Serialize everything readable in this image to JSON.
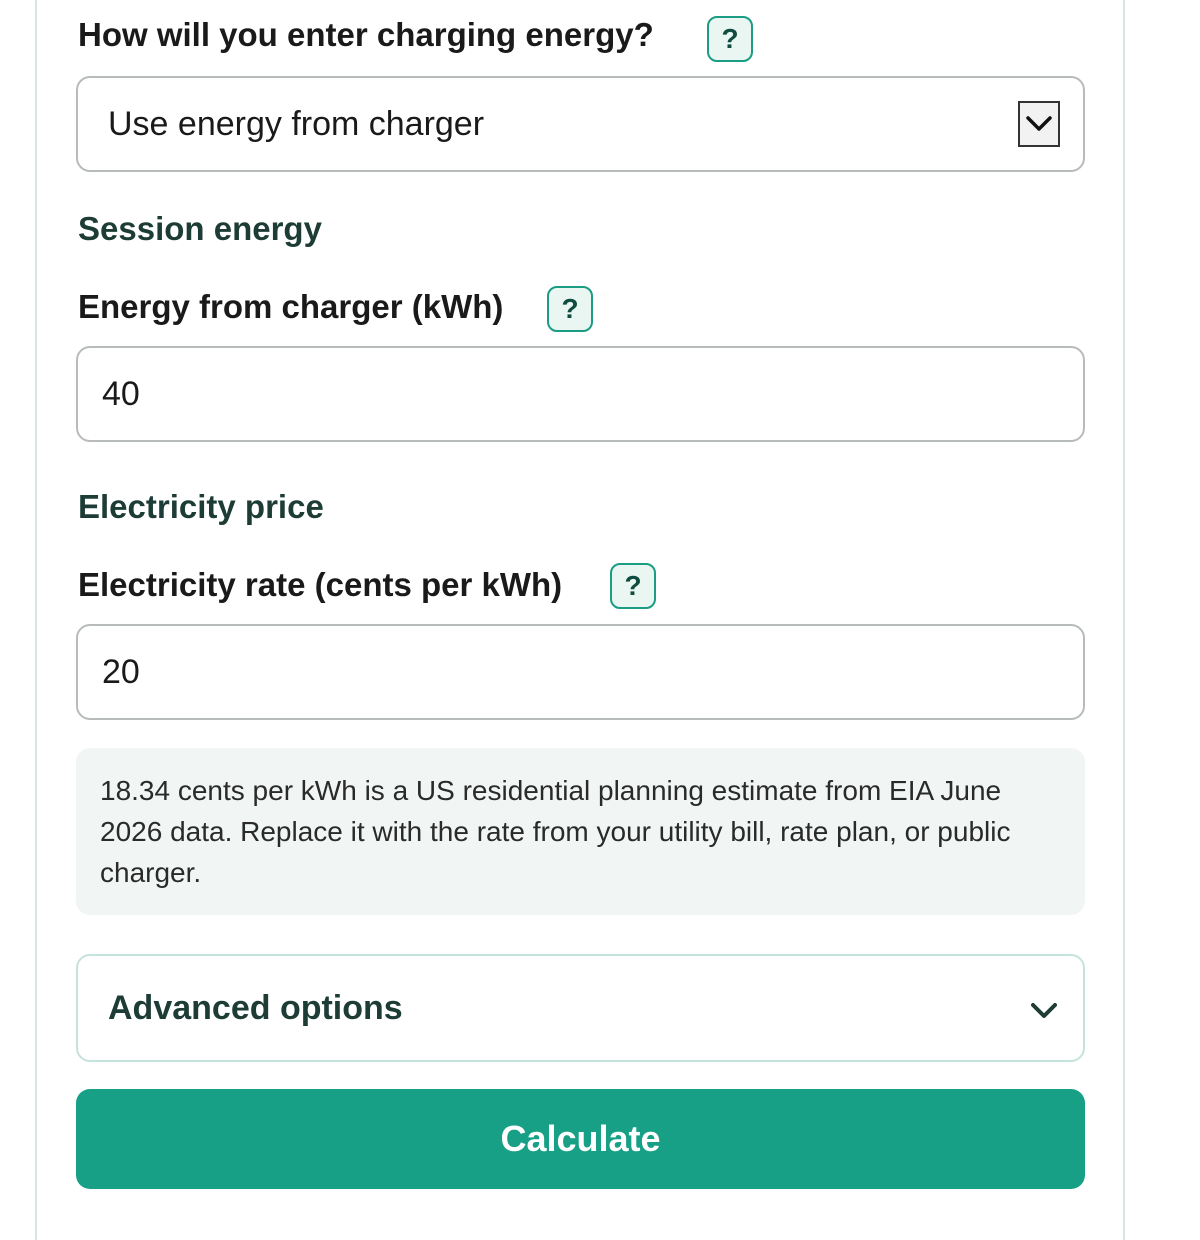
{
  "energy_method": {
    "question": "How will you enter charging energy?",
    "help_label": "?",
    "selected": "Use energy from charger"
  },
  "session": {
    "heading": "Session energy",
    "label": "Energy from charger (kWh)",
    "help_label": "?",
    "value": "40"
  },
  "price": {
    "heading": "Electricity price",
    "label": "Electricity rate (cents per kWh)",
    "help_label": "?",
    "value": "20",
    "note": "18.34 cents per kWh is a US residential planning estimate from EIA June 2026 data. Replace it with the rate from your utility bill, rate plan, or public charger."
  },
  "advanced": {
    "label": "Advanced options"
  },
  "actions": {
    "calculate_label": "Calculate"
  },
  "icons": {
    "help": "help-question-icon",
    "dropdown": "chevron-down-icon",
    "advanced_toggle": "chevron-down-icon"
  },
  "colors": {
    "accent": "#17a085",
    "help_border": "#1a9d82",
    "heading": "#1d3c35",
    "note_bg": "#f1f6f4"
  }
}
